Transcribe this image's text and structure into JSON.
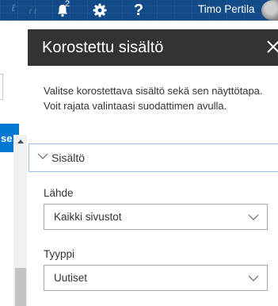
{
  "suitebar": {
    "notification_count": "2",
    "help_glyph": "?",
    "user_name": "Timo Pertila",
    "colors": {
      "background": "#124b87",
      "text": "#ffffff"
    },
    "icons": [
      "bell-icon",
      "gear-icon",
      "help-icon",
      "avatar"
    ]
  },
  "background_page": {
    "button_label": "se",
    "accent": "#0078d4"
  },
  "panel": {
    "title": "Korostettu sisältö",
    "description": "Valitse korostettava sisältö sekä sen näyttötapa. Voit rajata valintaasi suodattimen avulla.",
    "section": {
      "label": "Sisältö",
      "expanded": true
    },
    "fields": [
      {
        "label": "Lähde",
        "value": "Kaikki sivustot"
      },
      {
        "label": "Tyyppi",
        "value": "Uutiset"
      }
    ],
    "colors": {
      "header": "#333333",
      "section_border": "#9cbfe8"
    }
  }
}
